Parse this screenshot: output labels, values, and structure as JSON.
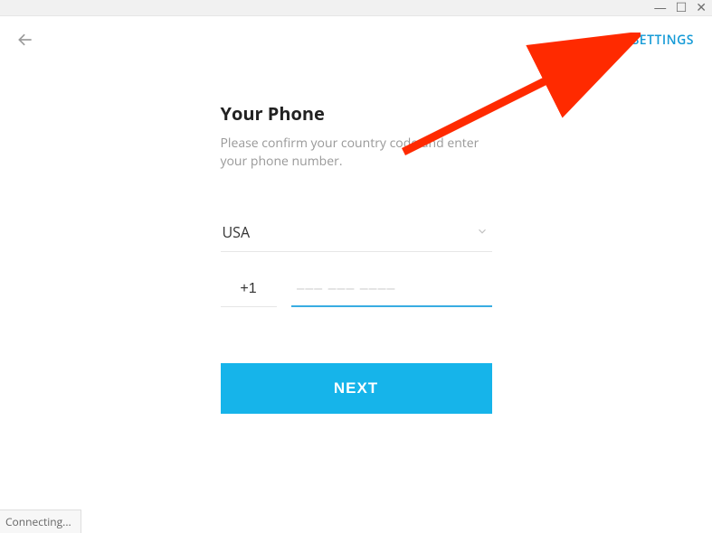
{
  "header": {
    "settings_label": "SETTINGS"
  },
  "form": {
    "title": "Your Phone",
    "subtitle": "Please confirm your country code and enter your phone number.",
    "country_selected": "USA",
    "dial_code": "+1",
    "phone_placeholder": "––– ––– ––––",
    "next_label": "NEXT"
  },
  "status": {
    "text": "Connecting..."
  },
  "colors": {
    "accent": "#16b4ea",
    "link": "#169bd7",
    "annotation_arrow": "#ff2a00"
  }
}
